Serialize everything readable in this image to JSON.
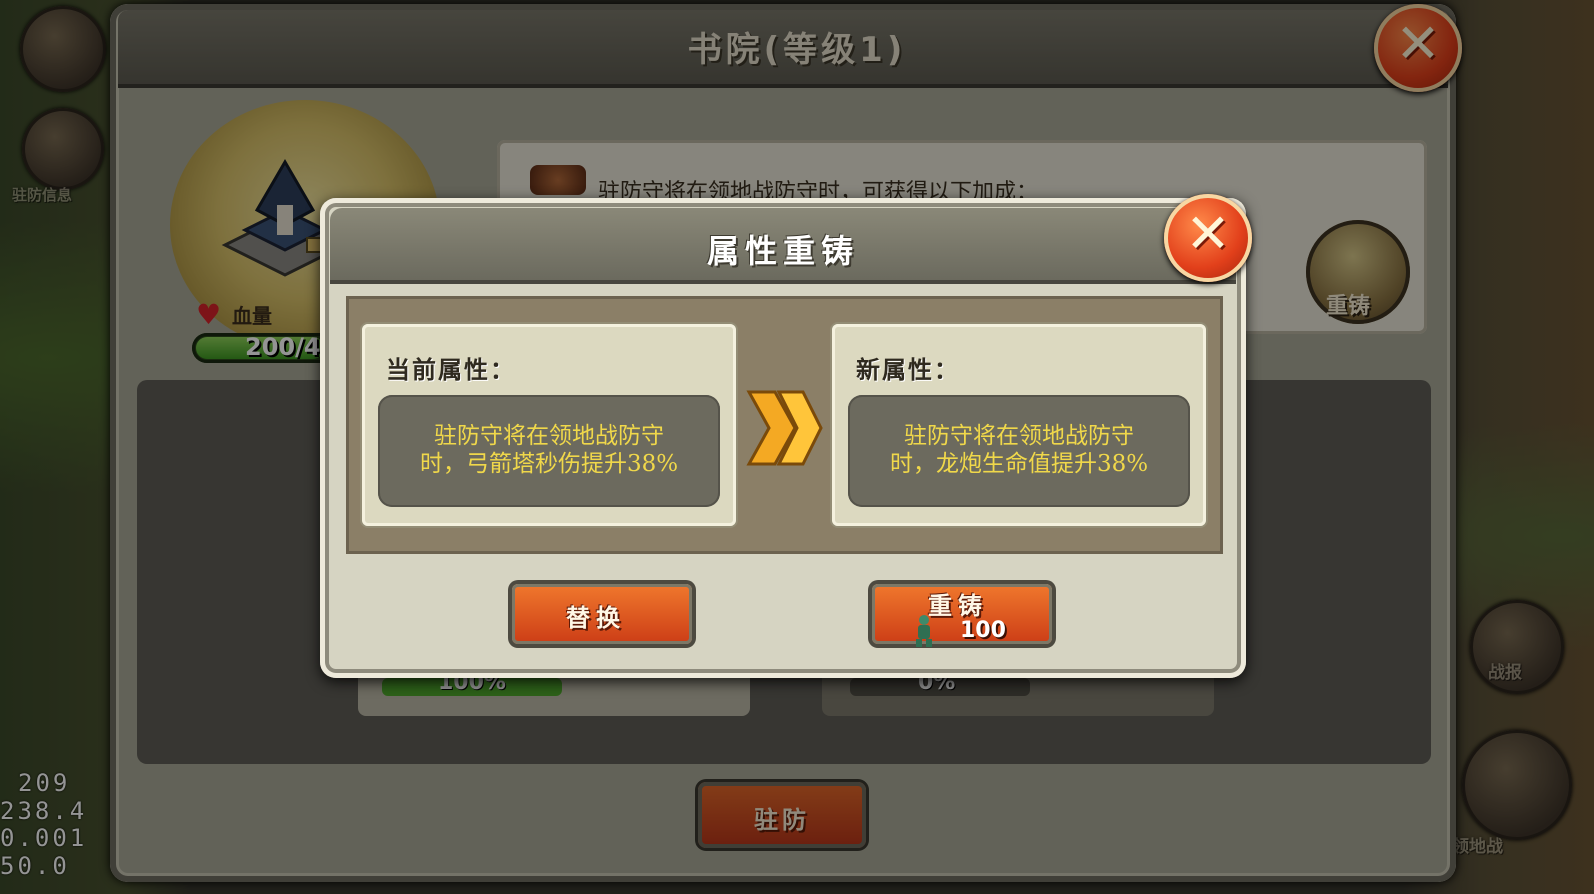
{
  "academy": {
    "title": "书院(等级1)",
    "hp_label": "血量",
    "hp_value": "200/4",
    "hp_fill_fraction": 0.9,
    "info_text": "驻防守将在领地战防守时，可获得以下加成：",
    "forge_label": "重铸",
    "slots": [
      {
        "percent": "100%",
        "fill_fraction": 1.0
      },
      {
        "percent": "0%",
        "fill_fraction": 0.0
      }
    ],
    "garrison_label": "驻防"
  },
  "side": {
    "left_label": "驻防信息",
    "right_battle_report": "战报",
    "right_territory_war": "领地战"
  },
  "debug": [
    "209",
    "238.4",
    "0.001",
    "50.0"
  ],
  "dialog": {
    "title": "属性重铸",
    "current": {
      "heading": "当前属性：",
      "line1": "驻防守将在领地战防守",
      "line2": "时，弓箭塔秒伤提升38%"
    },
    "new": {
      "heading": "新属性：",
      "line1": "驻防守将在领地战防守",
      "line2": "时，龙炮生命值提升38%"
    },
    "replace_label": "替换",
    "reforge_label": "重铸",
    "reforge_cost": "100"
  },
  "colors": {
    "accent_orange": "#e2401b",
    "attribute_text": "#f0d84a",
    "hp_green": "#3f9a23"
  },
  "icons": [
    "close-icon",
    "heart-icon",
    "double-chevron-right-icon",
    "bronze-figure-icon",
    "hammer-icon"
  ]
}
